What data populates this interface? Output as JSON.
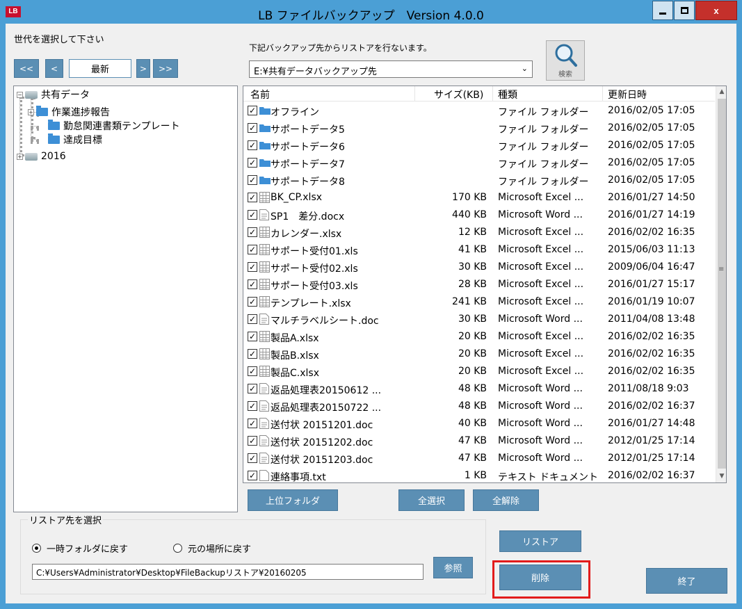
{
  "window": {
    "title": "LB ファイルバックアップ　Version 4.0.0",
    "icon_text": "LB",
    "close_label": "x"
  },
  "generation": {
    "label": "世代を選択して下さい",
    "nav": {
      "first": "<<",
      "prev": "<",
      "current": "最新",
      "next": ">",
      "last": ">>"
    }
  },
  "source": {
    "label": "下記バックアップ先からリストアを行ないます。",
    "selected": "E:¥共有データバックアップ先",
    "search_label": "検索"
  },
  "tree": {
    "root": "共有データ",
    "children": [
      "作業進捗報告",
      "勤怠関連書類テンプレート",
      "達成目標"
    ],
    "second_root": "2016"
  },
  "list": {
    "columns": [
      "名前",
      "サイズ(KB)",
      "種類",
      "更新日時"
    ],
    "rows": [
      {
        "name": "オフライン",
        "size": "",
        "type": "ファイル フォルダー",
        "date": "2016/02/05 17:05",
        "icon": "folder-icon",
        "checked": true
      },
      {
        "name": "サポートデータ5",
        "size": "",
        "type": "ファイル フォルダー",
        "date": "2016/02/05 17:05",
        "icon": "folder-icon",
        "checked": true
      },
      {
        "name": "サポートデータ6",
        "size": "",
        "type": "ファイル フォルダー",
        "date": "2016/02/05 17:05",
        "icon": "folder-icon",
        "checked": true
      },
      {
        "name": "サポートデータ7",
        "size": "",
        "type": "ファイル フォルダー",
        "date": "2016/02/05 17:05",
        "icon": "folder-icon",
        "checked": true
      },
      {
        "name": "サポートデータ8",
        "size": "",
        "type": "ファイル フォルダー",
        "date": "2016/02/05 17:05",
        "icon": "folder-icon",
        "checked": true
      },
      {
        "name": "BK_CP.xlsx",
        "size": "170 KB",
        "type": "Microsoft Excel ...",
        "date": "2016/01/27 14:50",
        "icon": "spreadsheet-icon",
        "checked": true
      },
      {
        "name": "SP1　差分.docx",
        "size": "440 KB",
        "type": "Microsoft Word ...",
        "date": "2016/01/27 14:19",
        "icon": "document-icon",
        "checked": true
      },
      {
        "name": "カレンダー.xlsx",
        "size": "12 KB",
        "type": "Microsoft Excel ...",
        "date": "2016/02/02 16:35",
        "icon": "spreadsheet-icon",
        "checked": true
      },
      {
        "name": "サポート受付01.xls",
        "size": "41 KB",
        "type": "Microsoft Excel ...",
        "date": "2015/06/03 11:13",
        "icon": "spreadsheet-icon",
        "checked": true
      },
      {
        "name": "サポート受付02.xls",
        "size": "30 KB",
        "type": "Microsoft Excel ...",
        "date": "2009/06/04 16:47",
        "icon": "spreadsheet-icon",
        "checked": true
      },
      {
        "name": "サポート受付03.xls",
        "size": "28 KB",
        "type": "Microsoft Excel ...",
        "date": "2016/01/27 15:17",
        "icon": "spreadsheet-icon",
        "checked": true
      },
      {
        "name": "テンプレート.xlsx",
        "size": "241 KB",
        "type": "Microsoft Excel ...",
        "date": "2016/01/19 10:07",
        "icon": "spreadsheet-icon",
        "checked": true
      },
      {
        "name": "マルチラベルシート.doc",
        "size": "30 KB",
        "type": "Microsoft Word ...",
        "date": "2011/04/08 13:48",
        "icon": "document-icon",
        "checked": true
      },
      {
        "name": "製品A.xlsx",
        "size": "20 KB",
        "type": "Microsoft Excel ...",
        "date": "2016/02/02 16:35",
        "icon": "spreadsheet-icon",
        "checked": true
      },
      {
        "name": "製品B.xlsx",
        "size": "20 KB",
        "type": "Microsoft Excel ...",
        "date": "2016/02/02 16:35",
        "icon": "spreadsheet-icon",
        "checked": true
      },
      {
        "name": "製品C.xlsx",
        "size": "20 KB",
        "type": "Microsoft Excel ...",
        "date": "2016/02/02 16:35",
        "icon": "spreadsheet-icon",
        "checked": true
      },
      {
        "name": "返品処理表20150612 ...",
        "size": "48 KB",
        "type": "Microsoft Word ...",
        "date": "2011/08/18 9:03",
        "icon": "document-icon",
        "checked": true
      },
      {
        "name": "返品処理表20150722 ...",
        "size": "48 KB",
        "type": "Microsoft Word ...",
        "date": "2016/02/02 16:37",
        "icon": "document-icon",
        "checked": true
      },
      {
        "name": "送付状 20151201.doc",
        "size": "40 KB",
        "type": "Microsoft Word ...",
        "date": "2016/01/27 14:48",
        "icon": "document-icon",
        "checked": true
      },
      {
        "name": "送付状 20151202.doc",
        "size": "47 KB",
        "type": "Microsoft Word ...",
        "date": "2012/01/25 17:14",
        "icon": "document-icon",
        "checked": true
      },
      {
        "name": "送付状 20151203.doc",
        "size": "47 KB",
        "type": "Microsoft Word ...",
        "date": "2012/01/25 17:14",
        "icon": "document-icon",
        "checked": true
      },
      {
        "name": "連絡事項.txt",
        "size": "1 KB",
        "type": "テキスト ドキュメント",
        "date": "2016/02/02 16:37",
        "icon": "text-file-icon",
        "checked": true
      }
    ]
  },
  "actions": {
    "parent_folder": "上位フォルダ",
    "select_all": "全選択",
    "deselect_all": "全解除",
    "restore": "リストア",
    "delete": "削除",
    "exit": "終了",
    "browse": "参照"
  },
  "restore_target": {
    "group_title": "リストア先を選択",
    "option_temp": "一時フォルダに戻す",
    "option_original": "元の場所に戻す",
    "selected": "temp",
    "path": "C:¥Users¥Administrator¥Desktop¥FileBackupリストア¥20160205"
  },
  "colors": {
    "frame": "#4b9fd5",
    "button": "#5b8fb4",
    "highlight": "#e21b1b",
    "close": "#c4302b"
  }
}
